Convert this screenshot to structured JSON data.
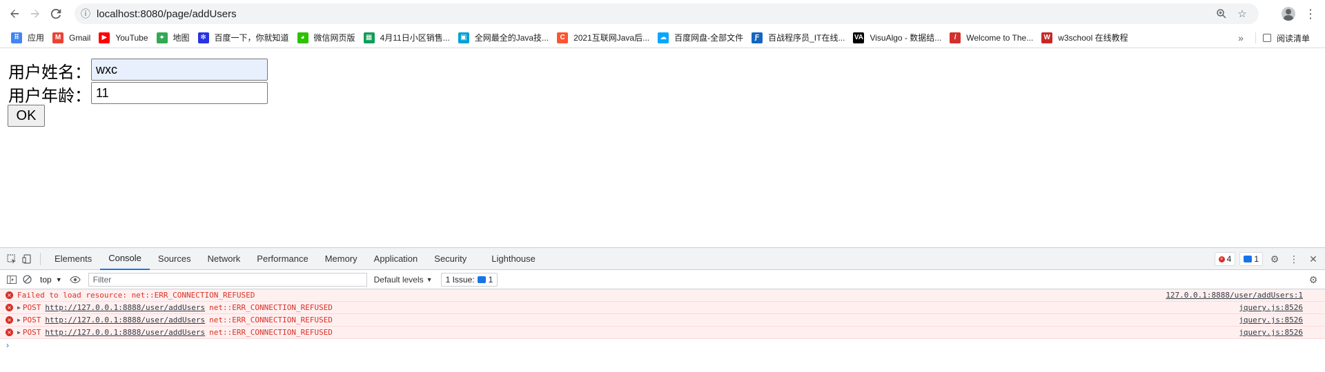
{
  "browser": {
    "url": "localhost:8080/page/addUsers",
    "back_icon": "arrow-left",
    "forward_icon": "arrow-right",
    "reload_icon": "reload",
    "info_icon": "info",
    "zoom_icon": "zoom",
    "star_icon": "star",
    "menu_icon": "vertical-dots"
  },
  "bookmarks": {
    "items": [
      {
        "label": "应用",
        "icon": "apps-grid",
        "color": "#4285f4"
      },
      {
        "label": "Gmail",
        "icon": "gmail",
        "color": "#ea4335"
      },
      {
        "label": "YouTube",
        "icon": "youtube",
        "color": "#ff0000"
      },
      {
        "label": "地图",
        "icon": "maps",
        "color": "#34a853"
      },
      {
        "label": "百度一下，你就知道",
        "icon": "baidu",
        "color": "#2932e1"
      },
      {
        "label": "微信网页版",
        "icon": "wechat",
        "color": "#2dc100"
      },
      {
        "label": "4月11日小区销售...",
        "icon": "sheet",
        "color": "#0f9d58"
      },
      {
        "label": "全网最全的Java技...",
        "icon": "bilibili",
        "color": "#00a1d6"
      },
      {
        "label": "2021互联网Java后...",
        "icon": "csdn",
        "color": "#fc5531"
      },
      {
        "label": "百度网盘-全部文件",
        "icon": "baidu-pan",
        "color": "#06a7ff"
      },
      {
        "label": "百战程序员_IT在线...",
        "icon": "bjsxt",
        "color": "#1565c0"
      },
      {
        "label": "VisuAlgo - 数据结...",
        "icon": "visualgo",
        "color": "#000000"
      },
      {
        "label": "Welcome to The...",
        "icon": "feather",
        "color": "#d32f2f"
      },
      {
        "label": "w3school 在线教程",
        "icon": "w3school",
        "color": "#c62828"
      }
    ],
    "more": "»",
    "reading_list": "阅读清单"
  },
  "form": {
    "name_label": "用户姓名：",
    "name_value": "wxc",
    "age_label": "用户年龄：",
    "age_value": "11",
    "submit_label": "OK"
  },
  "devtools": {
    "tabs": [
      "Elements",
      "Console",
      "Sources",
      "Network",
      "Performance",
      "Memory",
      "Application",
      "Security",
      "Lighthouse"
    ],
    "active_tab": "Console",
    "error_count": "4",
    "message_count": "1",
    "context": "top",
    "filter_placeholder": "Filter",
    "levels": "Default levels",
    "issues": "1 Issue:",
    "issues_count": "1",
    "console": [
      {
        "prefix": "Failed to load resource: net::ERR_CONNECTION_REFUSED",
        "url": "",
        "suffix": "",
        "source": "127.0.0.1:8888/user/addUsers:1",
        "expandable": false
      },
      {
        "prefix": "POST",
        "url": "http://127.0.0.1:8888/user/addUsers",
        "suffix": "net::ERR_CONNECTION_REFUSED",
        "source": "jquery.js:8526",
        "expandable": true
      },
      {
        "prefix": "POST",
        "url": "http://127.0.0.1:8888/user/addUsers",
        "suffix": "net::ERR_CONNECTION_REFUSED",
        "source": "jquery.js:8526",
        "expandable": true
      },
      {
        "prefix": "POST",
        "url": "http://127.0.0.1:8888/user/addUsers",
        "suffix": "net::ERR_CONNECTION_REFUSED",
        "source": "jquery.js:8526",
        "expandable": true
      }
    ],
    "prompt": "›",
    "error_color": "#d93025",
    "accent_color": "#1a73e8"
  }
}
